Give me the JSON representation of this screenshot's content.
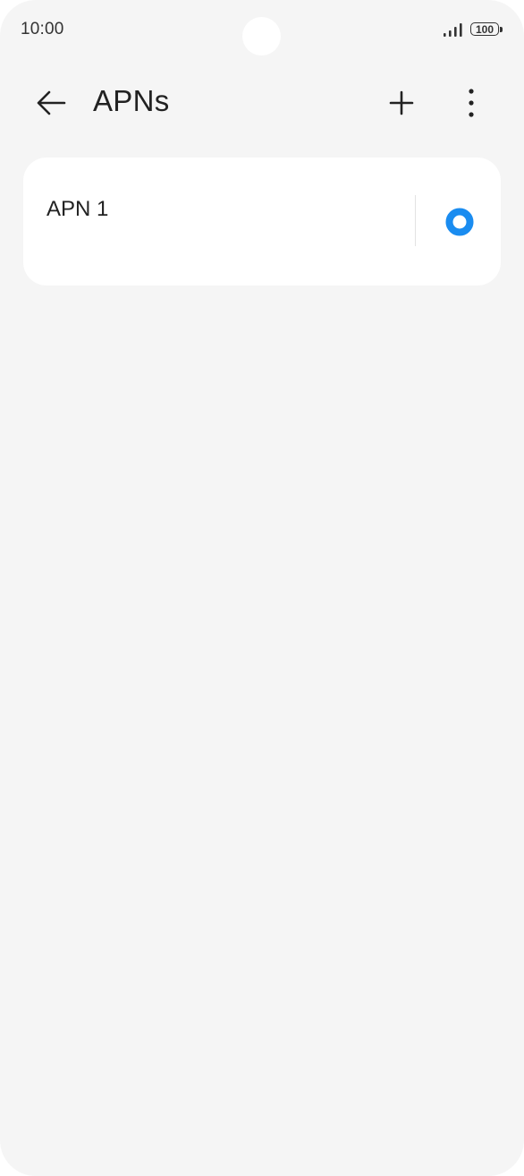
{
  "status_bar": {
    "time": "10:00",
    "battery_level": "100",
    "icons": [
      "signal-icon",
      "battery-icon"
    ]
  },
  "header": {
    "title": "APNs",
    "icons": [
      "back-arrow-icon",
      "plus-icon",
      "more-vertical-icon"
    ]
  },
  "apn_list": {
    "items": [
      {
        "name": "APN 1",
        "selected": true
      }
    ]
  },
  "colors": {
    "background": "#f5f5f5",
    "card": "#ffffff",
    "accent": "#1a8cf0",
    "text": "#222222"
  }
}
